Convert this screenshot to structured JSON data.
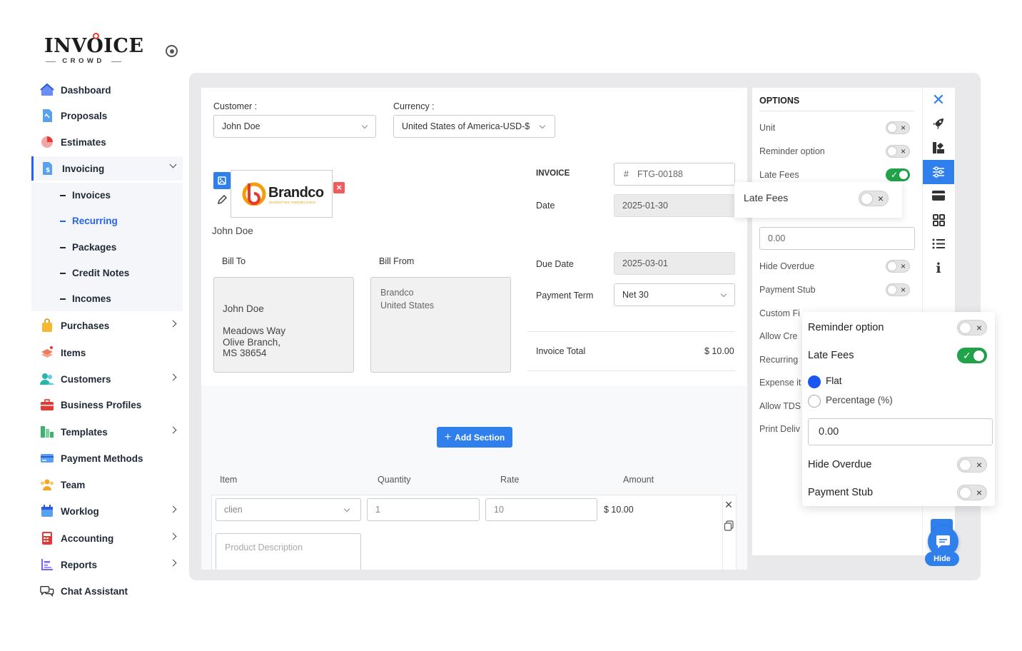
{
  "brand": {
    "name": "INVOICE",
    "sub": "CROWD"
  },
  "sidebar": {
    "items": [
      {
        "label": "Dashboard"
      },
      {
        "label": "Proposals"
      },
      {
        "label": "Estimates"
      },
      {
        "label": "Invoicing"
      },
      {
        "label": "Purchases"
      },
      {
        "label": "Items"
      },
      {
        "label": "Customers"
      },
      {
        "label": "Business Profiles"
      },
      {
        "label": "Templates"
      },
      {
        "label": "Payment Methods"
      },
      {
        "label": "Team"
      },
      {
        "label": "Worklog"
      },
      {
        "label": "Accounting"
      },
      {
        "label": "Reports"
      },
      {
        "label": "Chat Assistant"
      }
    ],
    "sub_items": [
      {
        "label": "Invoices"
      },
      {
        "label": "Recurring"
      },
      {
        "label": "Packages"
      },
      {
        "label": "Credit Notes"
      },
      {
        "label": "Incomes"
      }
    ]
  },
  "form": {
    "customer_label": "Customer :",
    "customer_value": "John Doe",
    "currency_label": "Currency :",
    "currency_value": "United States of America-USD-$",
    "logo_text": "Brandco",
    "logo_tagline": "MARKETING INMOBILIARIO",
    "customer_name": "John Doe",
    "invoice_label": "INVOICE",
    "invoice_prefix": "#",
    "invoice_number": "FTG-00188",
    "date_label": "Date",
    "date_value": "2025-01-30",
    "due_date_label": "Due Date",
    "due_date_value": "2025-03-01",
    "payment_term_label": "Payment Term",
    "payment_term_value": "Net 30",
    "bill_to_label": "Bill To",
    "bill_from_label": "Bill From",
    "bill_to": {
      "name": "John Doe",
      "line1": "Meadows Way",
      "line2": "Olive Branch,",
      "line3": "MS 38654"
    },
    "bill_from": {
      "line1": "Brandco",
      "line2": "United States"
    },
    "invoice_total_label": "Invoice Total",
    "invoice_total_value": "$ 10.00",
    "add_section": "Add Section",
    "items_header": {
      "item": "Item",
      "quantity": "Quantity",
      "rate": "Rate",
      "amount": "Amount"
    },
    "item_row": {
      "item": "clien",
      "quantity": "1",
      "rate": "10",
      "amount": "$ 10.00",
      "description_placeholder": "Product Description"
    }
  },
  "options": {
    "title": "OPTIONS",
    "items": [
      {
        "label": "Unit",
        "on": false
      },
      {
        "label": "Reminder option",
        "on": false
      },
      {
        "label": "Late Fees",
        "on": true
      },
      {
        "label": "Hide Overdue",
        "on": false
      },
      {
        "label": "Payment Stub",
        "on": false
      },
      {
        "label": "Custom Fi",
        "on": false
      },
      {
        "label": "Allow Cre",
        "on": false
      },
      {
        "label": "Recurring",
        "on": false
      },
      {
        "label": "Expense it",
        "on": false
      },
      {
        "label": "Allow TDS",
        "on": false
      },
      {
        "label": "Print Deliv",
        "on": false
      }
    ],
    "late_fee_value": "0.00"
  },
  "popup_small": {
    "label": "Late Fees",
    "on": false
  },
  "popup_big": {
    "reminder_label": "Reminder option",
    "late_fees_label": "Late Fees",
    "flat_label": "Flat",
    "percentage_label": "Percentage (%)",
    "amount_value": "0.00",
    "hide_overdue_label": "Hide Overdue",
    "payment_stub_label": "Payment Stub"
  },
  "chat": {
    "hide_label": "Hide"
  },
  "colors": {
    "accent": "#2f80ed",
    "toggle_on": "#20a349",
    "active_nav": "#2563eb"
  }
}
